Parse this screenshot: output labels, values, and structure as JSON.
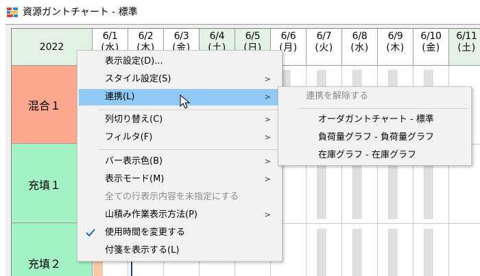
{
  "window": {
    "title": "資源ガントチャート - 標準",
    "icon": "gantt-app-icon",
    "colors": {
      "titlebar_bg": "#ffffff",
      "frame_bg": "#f0f0f0"
    }
  },
  "header": {
    "year": "2022",
    "days": [
      {
        "date": "6/1",
        "weekday": "(水)",
        "weekend": false
      },
      {
        "date": "6/2",
        "weekday": "(木)",
        "weekend": false
      },
      {
        "date": "6/3",
        "weekday": "(金)",
        "weekend": false
      },
      {
        "date": "6/4",
        "weekday": "(土)",
        "weekend": true
      },
      {
        "date": "6/5",
        "weekday": "(日)",
        "weekend": true
      },
      {
        "date": "6/6",
        "weekday": "(月)",
        "weekend": false
      },
      {
        "date": "6/7",
        "weekday": "(火)",
        "weekend": false
      },
      {
        "date": "6/8",
        "weekday": "(水)",
        "weekend": false
      },
      {
        "date": "6/9",
        "weekday": "(木)",
        "weekend": false
      },
      {
        "date": "6/10",
        "weekday": "(金)",
        "weekend": false
      },
      {
        "date": "6/11",
        "weekday": "(土)",
        "weekend": true
      }
    ],
    "colors": {
      "weekend_bg": "#e3f3e3",
      "weekday_bg": "#ffffff"
    }
  },
  "rows": [
    {
      "label": "混合１",
      "color": "#fca88e"
    },
    {
      "label": "充填１",
      "color": "#a2f2c5"
    },
    {
      "label": "充填２",
      "color": "#a2f2c5"
    }
  ],
  "context_menu": {
    "items": [
      {
        "label": "表示設定(D)...",
        "submenu": false,
        "disabled": false,
        "highlight": false
      },
      {
        "label": "スタイル設定(S)",
        "submenu": true,
        "disabled": false,
        "highlight": false
      },
      {
        "label": "連携(L)",
        "submenu": true,
        "disabled": false,
        "highlight": true
      },
      {
        "label": "列切り替え(C)",
        "submenu": true,
        "disabled": false,
        "highlight": false
      },
      {
        "label": "フィルタ(F)",
        "submenu": true,
        "disabled": false,
        "highlight": false
      },
      {
        "label": "バー表示色(B)",
        "submenu": true,
        "disabled": false,
        "highlight": false
      },
      {
        "label": "表示モード(M)",
        "submenu": true,
        "disabled": false,
        "highlight": false
      },
      {
        "label": "全ての行表示内容を未指定にする",
        "submenu": false,
        "disabled": true,
        "highlight": false
      },
      {
        "label": "山積み作業表示方法(P)",
        "submenu": true,
        "disabled": false,
        "highlight": false
      },
      {
        "label": "使用時間を変更する",
        "submenu": false,
        "disabled": false,
        "highlight": false,
        "checked": true
      },
      {
        "label": "付箋を表示する(L)",
        "submenu": false,
        "disabled": false,
        "highlight": false
      }
    ],
    "colors": {
      "highlight_bg": "#91c9f7",
      "menu_bg": "#f2f2f2",
      "disabled_text": "#8a8a8a",
      "check": "#1565c0"
    },
    "check_icon": "checkmark-icon",
    "submenu_arrow_icon": "chevron-right-icon"
  },
  "link_submenu": {
    "items": [
      {
        "label": "連携を解除する",
        "disabled": true
      },
      {
        "label": "オーダガントチャート - 標準",
        "disabled": false
      },
      {
        "label": "負荷量グラフ - 負荷量グラフ",
        "disabled": false
      },
      {
        "label": "在庫グラフ - 在庫グラフ",
        "disabled": false
      }
    ]
  },
  "cursor": {
    "icon": "mouse-pointer-icon"
  }
}
